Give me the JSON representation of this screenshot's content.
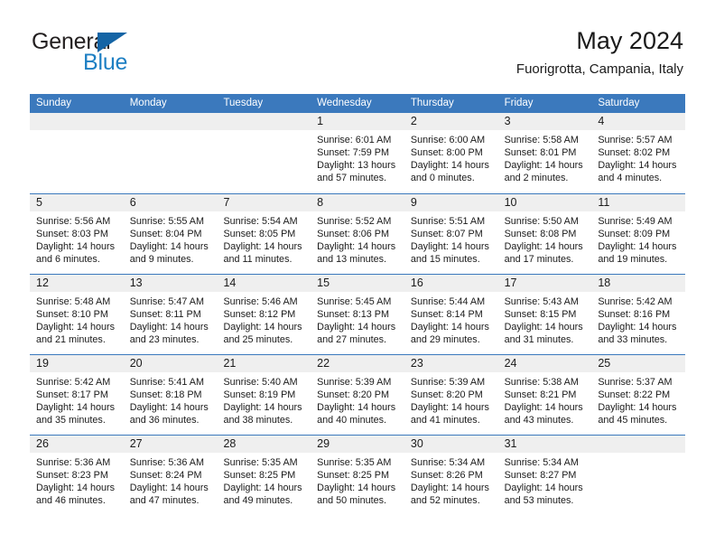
{
  "brand": {
    "name_part1": "General",
    "name_part2": "Blue",
    "triangle_color": "#1464a5",
    "blue_color": "#1d7fc3"
  },
  "header": {
    "title": "May 2024",
    "subtitle": "Fuorigrotta, Campania, Italy"
  },
  "theme": {
    "header_row_bg": "#3b79bd",
    "day_band_bg": "#efefef",
    "grid_line": "#3b79bd"
  },
  "weekdays": [
    "Sunday",
    "Monday",
    "Tuesday",
    "Wednesday",
    "Thursday",
    "Friday",
    "Saturday"
  ],
  "weeks": [
    [
      {
        "day": "",
        "lines": []
      },
      {
        "day": "",
        "lines": []
      },
      {
        "day": "",
        "lines": []
      },
      {
        "day": "1",
        "lines": [
          "Sunrise: 6:01 AM",
          "Sunset: 7:59 PM",
          "Daylight: 13 hours",
          "and 57 minutes."
        ]
      },
      {
        "day": "2",
        "lines": [
          "Sunrise: 6:00 AM",
          "Sunset: 8:00 PM",
          "Daylight: 14 hours",
          "and 0 minutes."
        ]
      },
      {
        "day": "3",
        "lines": [
          "Sunrise: 5:58 AM",
          "Sunset: 8:01 PM",
          "Daylight: 14 hours",
          "and 2 minutes."
        ]
      },
      {
        "day": "4",
        "lines": [
          "Sunrise: 5:57 AM",
          "Sunset: 8:02 PM",
          "Daylight: 14 hours",
          "and 4 minutes."
        ]
      }
    ],
    [
      {
        "day": "5",
        "lines": [
          "Sunrise: 5:56 AM",
          "Sunset: 8:03 PM",
          "Daylight: 14 hours",
          "and 6 minutes."
        ]
      },
      {
        "day": "6",
        "lines": [
          "Sunrise: 5:55 AM",
          "Sunset: 8:04 PM",
          "Daylight: 14 hours",
          "and 9 minutes."
        ]
      },
      {
        "day": "7",
        "lines": [
          "Sunrise: 5:54 AM",
          "Sunset: 8:05 PM",
          "Daylight: 14 hours",
          "and 11 minutes."
        ]
      },
      {
        "day": "8",
        "lines": [
          "Sunrise: 5:52 AM",
          "Sunset: 8:06 PM",
          "Daylight: 14 hours",
          "and 13 minutes."
        ]
      },
      {
        "day": "9",
        "lines": [
          "Sunrise: 5:51 AM",
          "Sunset: 8:07 PM",
          "Daylight: 14 hours",
          "and 15 minutes."
        ]
      },
      {
        "day": "10",
        "lines": [
          "Sunrise: 5:50 AM",
          "Sunset: 8:08 PM",
          "Daylight: 14 hours",
          "and 17 minutes."
        ]
      },
      {
        "day": "11",
        "lines": [
          "Sunrise: 5:49 AM",
          "Sunset: 8:09 PM",
          "Daylight: 14 hours",
          "and 19 minutes."
        ]
      }
    ],
    [
      {
        "day": "12",
        "lines": [
          "Sunrise: 5:48 AM",
          "Sunset: 8:10 PM",
          "Daylight: 14 hours",
          "and 21 minutes."
        ]
      },
      {
        "day": "13",
        "lines": [
          "Sunrise: 5:47 AM",
          "Sunset: 8:11 PM",
          "Daylight: 14 hours",
          "and 23 minutes."
        ]
      },
      {
        "day": "14",
        "lines": [
          "Sunrise: 5:46 AM",
          "Sunset: 8:12 PM",
          "Daylight: 14 hours",
          "and 25 minutes."
        ]
      },
      {
        "day": "15",
        "lines": [
          "Sunrise: 5:45 AM",
          "Sunset: 8:13 PM",
          "Daylight: 14 hours",
          "and 27 minutes."
        ]
      },
      {
        "day": "16",
        "lines": [
          "Sunrise: 5:44 AM",
          "Sunset: 8:14 PM",
          "Daylight: 14 hours",
          "and 29 minutes."
        ]
      },
      {
        "day": "17",
        "lines": [
          "Sunrise: 5:43 AM",
          "Sunset: 8:15 PM",
          "Daylight: 14 hours",
          "and 31 minutes."
        ]
      },
      {
        "day": "18",
        "lines": [
          "Sunrise: 5:42 AM",
          "Sunset: 8:16 PM",
          "Daylight: 14 hours",
          "and 33 minutes."
        ]
      }
    ],
    [
      {
        "day": "19",
        "lines": [
          "Sunrise: 5:42 AM",
          "Sunset: 8:17 PM",
          "Daylight: 14 hours",
          "and 35 minutes."
        ]
      },
      {
        "day": "20",
        "lines": [
          "Sunrise: 5:41 AM",
          "Sunset: 8:18 PM",
          "Daylight: 14 hours",
          "and 36 minutes."
        ]
      },
      {
        "day": "21",
        "lines": [
          "Sunrise: 5:40 AM",
          "Sunset: 8:19 PM",
          "Daylight: 14 hours",
          "and 38 minutes."
        ]
      },
      {
        "day": "22",
        "lines": [
          "Sunrise: 5:39 AM",
          "Sunset: 8:20 PM",
          "Daylight: 14 hours",
          "and 40 minutes."
        ]
      },
      {
        "day": "23",
        "lines": [
          "Sunrise: 5:39 AM",
          "Sunset: 8:20 PM",
          "Daylight: 14 hours",
          "and 41 minutes."
        ]
      },
      {
        "day": "24",
        "lines": [
          "Sunrise: 5:38 AM",
          "Sunset: 8:21 PM",
          "Daylight: 14 hours",
          "and 43 minutes."
        ]
      },
      {
        "day": "25",
        "lines": [
          "Sunrise: 5:37 AM",
          "Sunset: 8:22 PM",
          "Daylight: 14 hours",
          "and 45 minutes."
        ]
      }
    ],
    [
      {
        "day": "26",
        "lines": [
          "Sunrise: 5:36 AM",
          "Sunset: 8:23 PM",
          "Daylight: 14 hours",
          "and 46 minutes."
        ]
      },
      {
        "day": "27",
        "lines": [
          "Sunrise: 5:36 AM",
          "Sunset: 8:24 PM",
          "Daylight: 14 hours",
          "and 47 minutes."
        ]
      },
      {
        "day": "28",
        "lines": [
          "Sunrise: 5:35 AM",
          "Sunset: 8:25 PM",
          "Daylight: 14 hours",
          "and 49 minutes."
        ]
      },
      {
        "day": "29",
        "lines": [
          "Sunrise: 5:35 AM",
          "Sunset: 8:25 PM",
          "Daylight: 14 hours",
          "and 50 minutes."
        ]
      },
      {
        "day": "30",
        "lines": [
          "Sunrise: 5:34 AM",
          "Sunset: 8:26 PM",
          "Daylight: 14 hours",
          "and 52 minutes."
        ]
      },
      {
        "day": "31",
        "lines": [
          "Sunrise: 5:34 AM",
          "Sunset: 8:27 PM",
          "Daylight: 14 hours",
          "and 53 minutes."
        ]
      },
      {
        "day": "",
        "lines": []
      }
    ]
  ]
}
